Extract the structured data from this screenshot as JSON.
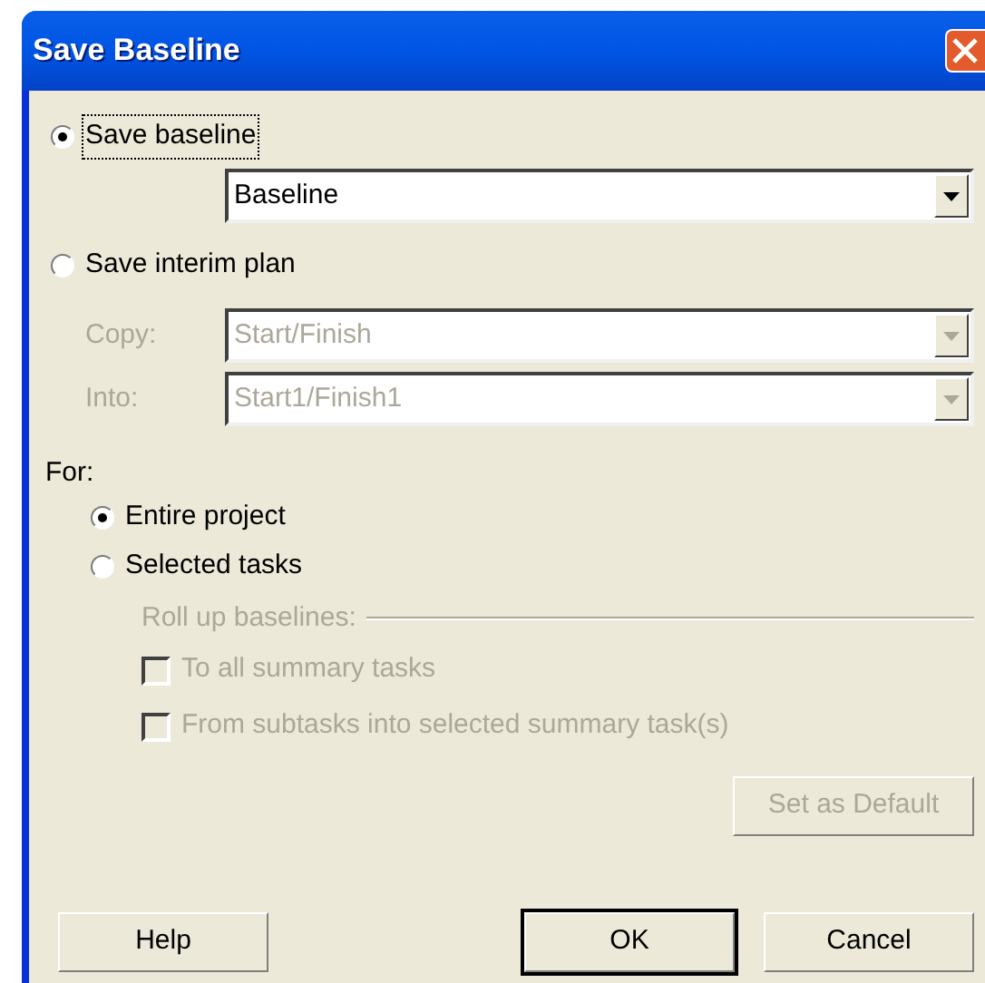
{
  "window": {
    "title": "Save Baseline"
  },
  "save_options": [
    {
      "label": "Save baseline",
      "selected": true,
      "focused": true
    },
    {
      "label": "Save interim plan",
      "selected": false,
      "focused": false
    }
  ],
  "baseline_dropdown": {
    "value": "Baseline",
    "disabled": false
  },
  "interim_fields": [
    {
      "label": "Copy:",
      "value": "Start/Finish",
      "disabled": true
    },
    {
      "label": "Into:",
      "value": "Start1/Finish1",
      "disabled": true
    }
  ],
  "for_label": "For:",
  "scope_options": [
    {
      "label": "Entire project",
      "selected": true
    },
    {
      "label": "Selected tasks",
      "selected": false
    }
  ],
  "rollup": {
    "label": "Roll up baselines:",
    "disabled": true,
    "options": [
      {
        "label": "To all summary tasks",
        "checked": false
      },
      {
        "label": "From subtasks into selected summary task(s)",
        "checked": false
      }
    ]
  },
  "set_default_button": {
    "label": "Set as Default",
    "disabled": true
  },
  "buttons": [
    {
      "label": "Help",
      "default": false
    },
    {
      "label": "OK",
      "default": true
    },
    {
      "label": "Cancel",
      "default": false
    }
  ]
}
